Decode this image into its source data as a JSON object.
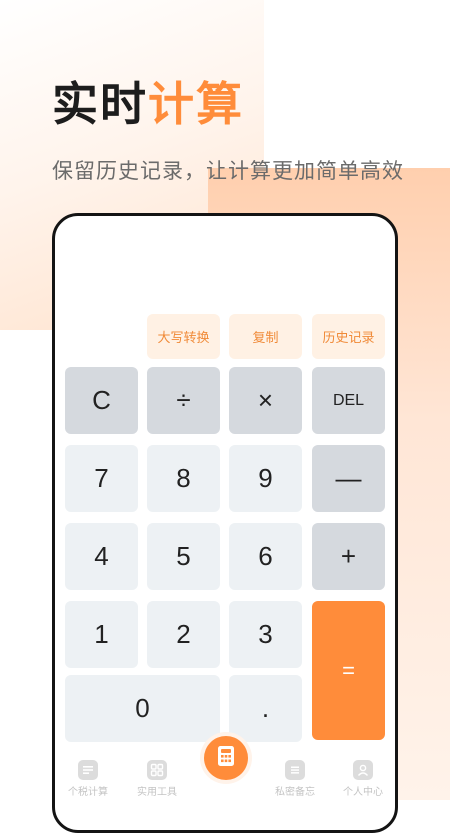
{
  "header": {
    "title_part1": "实时",
    "title_part2": "计算",
    "subtitle": "保留历史记录，让计算更加简单高效"
  },
  "functions": {
    "uppercase": "大写转换",
    "copy": "复制",
    "history": "历史记录"
  },
  "keys": {
    "clear": "C",
    "divide": "÷",
    "multiply": "×",
    "delete": "DEL",
    "seven": "7",
    "eight": "8",
    "nine": "9",
    "minus": "—",
    "four": "4",
    "five": "5",
    "six": "6",
    "plus": "+",
    "one": "1",
    "two": "2",
    "three": "3",
    "equals": "=",
    "zero": "0",
    "dot": "."
  },
  "nav": {
    "tax": "个税计算",
    "tools": "实用工具",
    "notes": "私密备忘",
    "profile": "个人中心"
  },
  "colors": {
    "accent": "#ff8c3a",
    "func_bg": "#fff1e4",
    "key_light": "#edf1f4",
    "key_gray": "#d5d9de"
  }
}
